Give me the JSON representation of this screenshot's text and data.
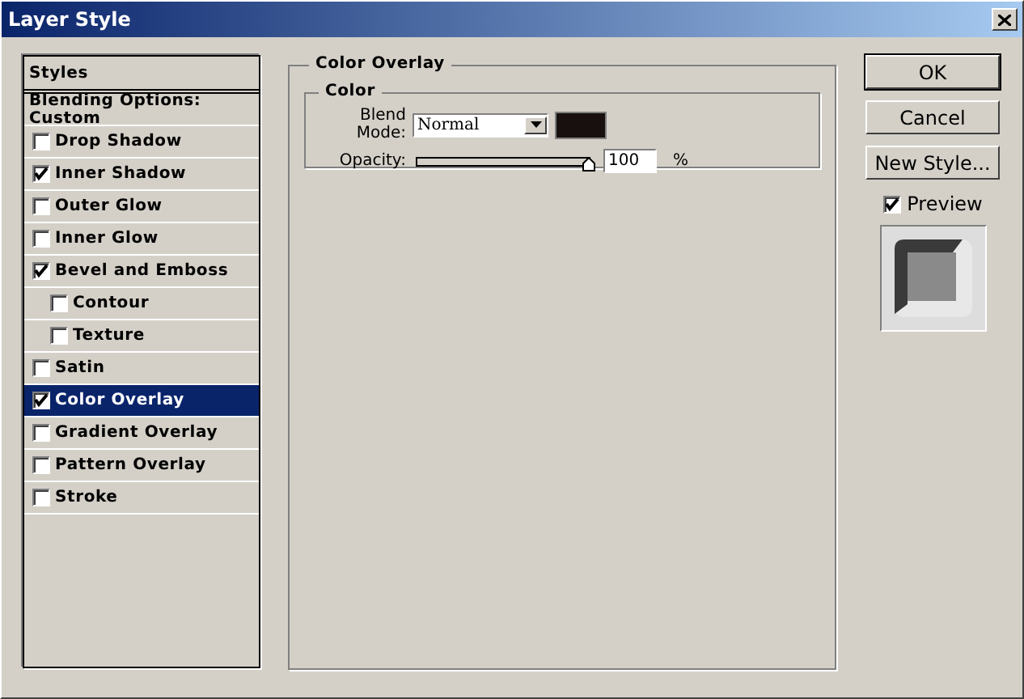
{
  "window": {
    "title": "Layer Style"
  },
  "styles_panel": {
    "heading": "Styles",
    "blending": "Blending Options: Custom",
    "items": [
      {
        "label": "Drop Shadow",
        "checked": false,
        "selected": false
      },
      {
        "label": "Inner Shadow",
        "checked": true,
        "selected": false
      },
      {
        "label": "Outer Glow",
        "checked": false,
        "selected": false
      },
      {
        "label": "Inner Glow",
        "checked": false,
        "selected": false
      },
      {
        "label": "Bevel and Emboss",
        "checked": true,
        "selected": false,
        "children": [
          {
            "label": "Contour",
            "checked": false,
            "selected": false
          },
          {
            "label": "Texture",
            "checked": false,
            "selected": false
          }
        ]
      },
      {
        "label": "Satin",
        "checked": false,
        "selected": false
      },
      {
        "label": "Color Overlay",
        "checked": true,
        "selected": true
      },
      {
        "label": "Gradient Overlay",
        "checked": false,
        "selected": false
      },
      {
        "label": "Pattern Overlay",
        "checked": false,
        "selected": false
      },
      {
        "label": "Stroke",
        "checked": false,
        "selected": false
      }
    ]
  },
  "color_overlay": {
    "title": "Color Overlay",
    "group": "Color",
    "blend_label": "Blend Mode:",
    "blend_value": "Normal",
    "swatch": {
      "color": "#17100e"
    },
    "opacity_label": "Opacity:",
    "opacity": {
      "level": 1
    },
    "opacity_value": "100",
    "unit": "%"
  },
  "buttons": [
    "OK",
    "Cancel",
    "New Style..."
  ],
  "preview": {
    "label": "Preview",
    "checked": true
  }
}
